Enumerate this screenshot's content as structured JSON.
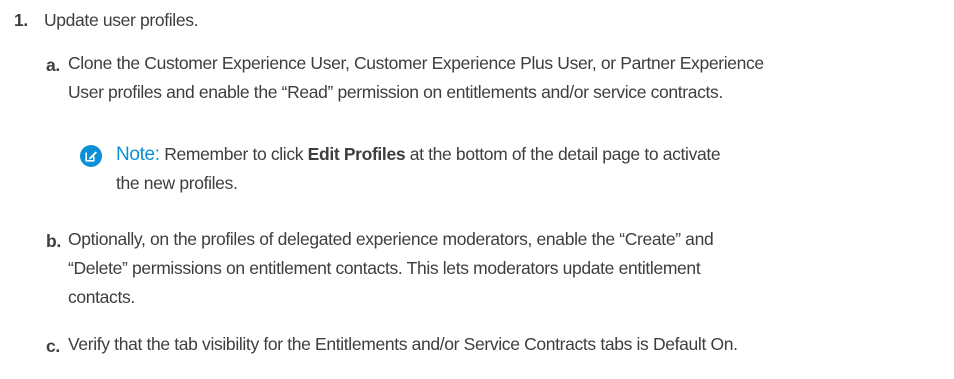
{
  "step": {
    "number": "1.",
    "title": "Update user profiles."
  },
  "substeps": [
    {
      "letter": "a.",
      "lines": [
        "Clone the Customer Experience User, Customer Experience Plus User, or Partner Experience",
        "User profiles and enable the “Read” permission on entitlements and/or service contracts."
      ]
    },
    {
      "letter": "b.",
      "lines": [
        "Optionally, on the profiles of delegated experience moderators, enable the “Create” and",
        "“Delete” permissions on entitlement contacts. This lets moderators update entitlement",
        "contacts."
      ]
    },
    {
      "letter": "c.",
      "lines": [
        "Verify that the tab visibility for the Entitlements and/or Service Contracts tabs is Default On."
      ]
    }
  ],
  "note": {
    "icon": "edit-note-icon",
    "label": "Note:",
    "text_before": "Remember to click",
    "bold": "Edit Profiles",
    "text_after": "at the bottom of the detail page to activate",
    "line2": "the new profiles.",
    "color": "#0b8fd6"
  }
}
